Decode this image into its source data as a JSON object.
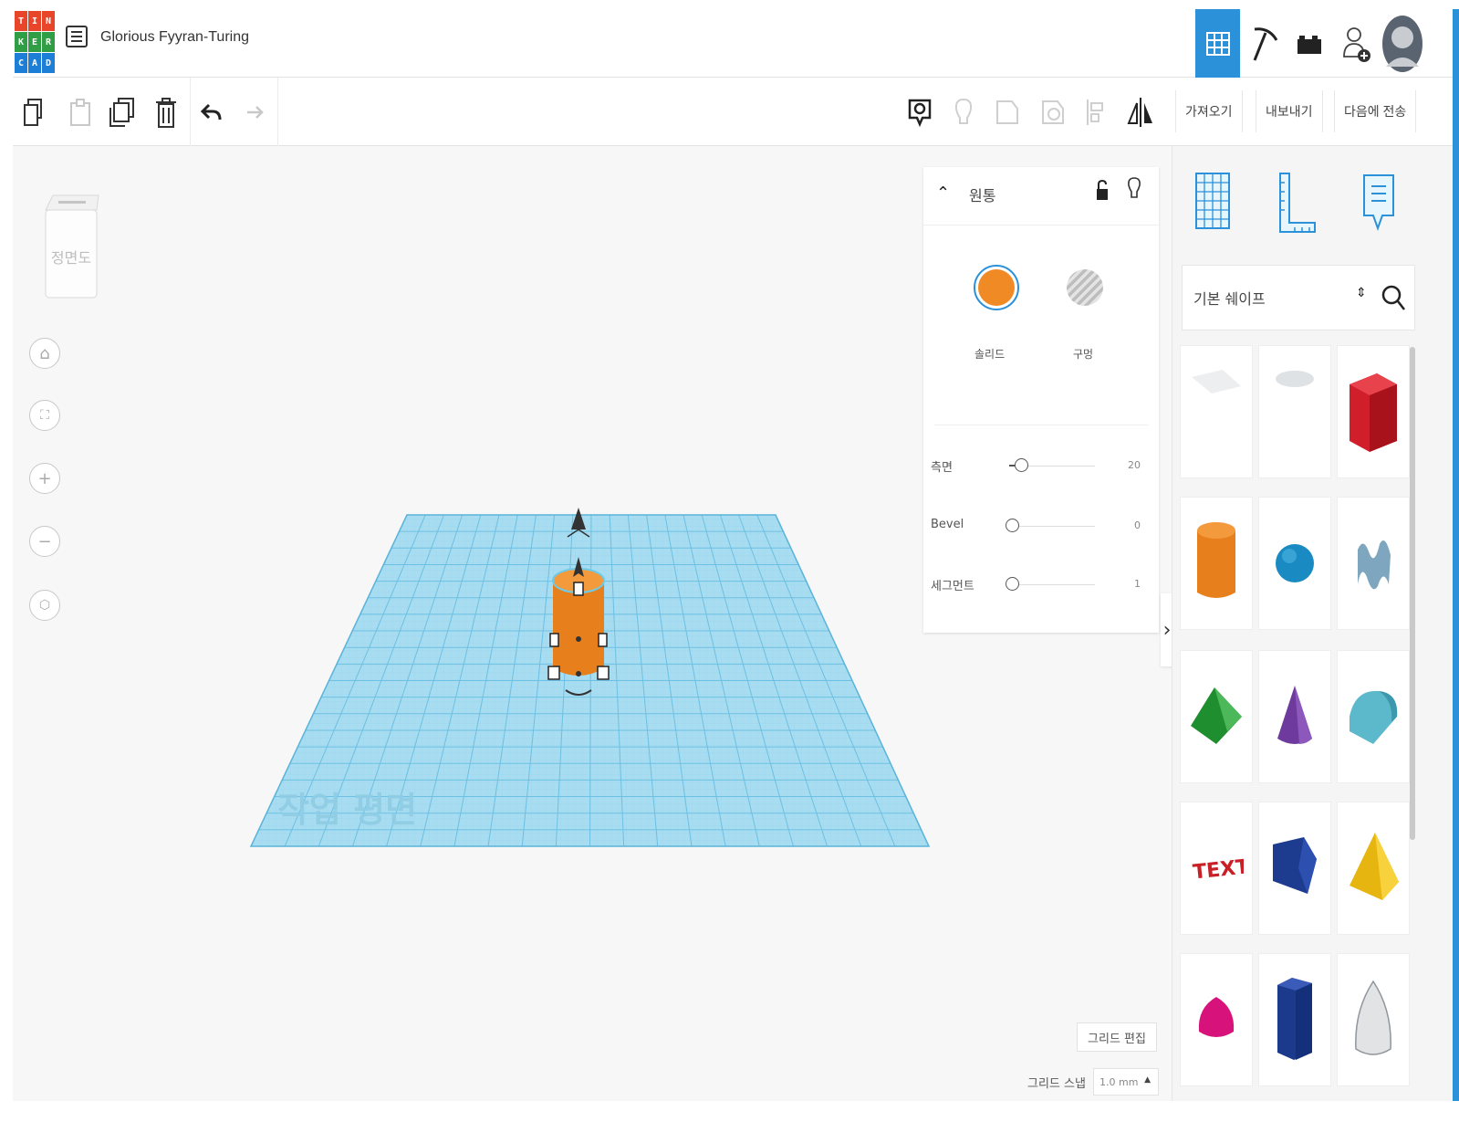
{
  "app": {
    "logo_letters": [
      "T",
      "I",
      "N",
      "K",
      "E",
      "R",
      "C",
      "A",
      "D"
    ],
    "logo_colors": [
      "#e8462b",
      "#e8462b",
      "#e8462b",
      "#2f9e44",
      "#2f9e44",
      "#2f9e44",
      "#1c7ed6",
      "#1c7ed6",
      "#1c7ed6"
    ],
    "project_name": "Glorious Fyyran-Turing"
  },
  "header": {
    "buttons": [
      {
        "name": "3d-design-view",
        "icon": "grid-icon",
        "active": true
      },
      {
        "name": "codeblocks-view",
        "icon": "pickaxe-icon"
      },
      {
        "name": "lego-bricks-view",
        "icon": "brick-icon"
      },
      {
        "name": "add-user",
        "icon": "add-user-icon"
      },
      {
        "name": "profile",
        "icon": "avatar"
      }
    ]
  },
  "toolbar": {
    "import_label": "가져오기",
    "export_label": "내보내기",
    "send_to_label": "다음에 전송"
  },
  "viewport": {
    "view_cube_label": "정면도",
    "workplane_label": "작업 평면",
    "grid_edit_label": "그리드 편집",
    "grid_snap_label": "그리드 스냅",
    "grid_snap_value": "1.0 mm"
  },
  "inspector": {
    "shape_name": "원통",
    "solid_label": "솔리드",
    "hole_label": "구멍",
    "properties": [
      {
        "label": "측면",
        "value": "20"
      },
      {
        "label": "Bevel",
        "value": "0"
      },
      {
        "label": "세그먼트",
        "value": "1"
      }
    ]
  },
  "shapes_panel": {
    "category": "기본 쉐이프",
    "shapes": [
      "box-hole",
      "cylinder-hole",
      "box",
      "cylinder",
      "sphere",
      "scribble",
      "roof",
      "cone",
      "round-roof",
      "text",
      "wedge",
      "pyramid",
      "paraboloid",
      "polygon",
      "half-sphere"
    ]
  },
  "colors": {
    "accent": "#2b91d9",
    "workplane": "#9fd8ef",
    "shape_orange": "#f08a24",
    "grid_line": "#6cc0e3"
  }
}
